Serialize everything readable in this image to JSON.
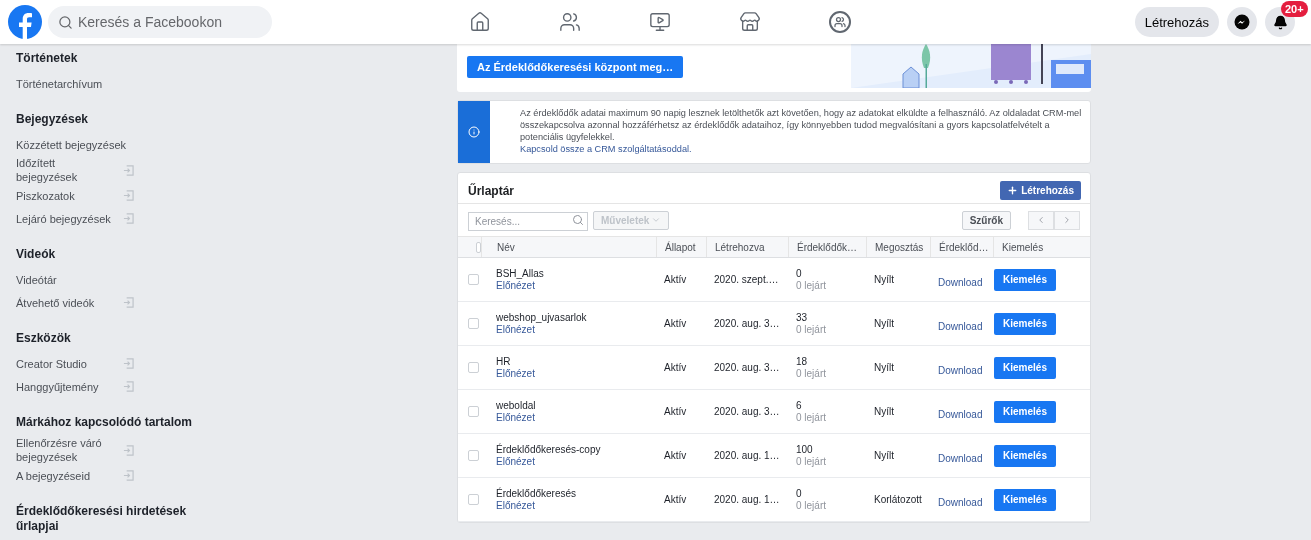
{
  "header": {
    "search": {
      "placeholder": "Keresés a Facebookon"
    },
    "create_button": "Létrehozás",
    "notification_badge": "20+"
  },
  "sidebar": {
    "sections": [
      {
        "title": "Történetek",
        "items": [
          {
            "label": "Történetarchívum",
            "external": false
          }
        ]
      },
      {
        "title": "Bejegyzések",
        "items": [
          {
            "label": "Közzétett bejegyzések",
            "external": false
          },
          {
            "label": "Időzített bejegyzések",
            "external": true
          },
          {
            "label": "Piszkozatok",
            "external": true
          },
          {
            "label": "Lejáró bejegyzések",
            "external": true
          }
        ]
      },
      {
        "title": "Videók",
        "items": [
          {
            "label": "Videótár",
            "external": false
          },
          {
            "label": "Átvehető videók",
            "external": true
          }
        ]
      },
      {
        "title": "Eszközök",
        "items": [
          {
            "label": "Creator Studio",
            "external": true
          },
          {
            "label": "Hanggyűjtemény",
            "external": true
          }
        ]
      },
      {
        "title": "Márkához kapcsolódó tartalom",
        "items": [
          {
            "label": "Ellenőrzésre váró bejegyzések",
            "external": true
          },
          {
            "label": "A bejegyzéseid",
            "external": true
          }
        ]
      },
      {
        "title": "Érdeklődőkeresési hirdetések űrlapjai"
      }
    ]
  },
  "banner": {
    "button": "Az Érdeklődőkeresési központ meg…"
  },
  "info": {
    "text": "Az érdeklődők adatai maximum 90 napig lesznek letölthetők azt követően, hogy az adatokat elküldte a felhasználó. Az oldaladat CRM-mel összekapcsolva azonnal hozzáférhetsz az érdeklődők adataihoz, így könnyebben tudod megvalósítani a gyors kapcsolatfelvételt a potenciális ügyfelekkel.",
    "link": "Kapcsold össze a CRM szolgáltatásoddal."
  },
  "library": {
    "title": "Űrlaptár",
    "create_button": "Létrehozás",
    "search": {
      "placeholder": "Keresés..."
    },
    "actions_button": "Műveletek",
    "select_all_checked": false,
    "filters_button": "Szűrők",
    "columns": [
      "Név",
      "Állapot",
      "Létrehozva",
      "Érdeklődők…",
      "Megosztás",
      "Érdeklőd…",
      "Kiemelés"
    ],
    "rows": [
      {
        "checked": false,
        "name": "BSH_Allas",
        "preview": "Előnézet",
        "status": "Aktív",
        "created": "2020. szept.…",
        "leads": "0",
        "expired": "0 lejárt",
        "sharing": "Nyílt",
        "download": "Download",
        "boost": "Kiemelés"
      },
      {
        "checked": false,
        "name": "webshop_ujvasarlok",
        "preview": "Előnézet",
        "status": "Aktív",
        "created": "2020. aug. 3…",
        "leads": "33",
        "expired": "0 lejárt",
        "sharing": "Nyílt",
        "download": "Download",
        "boost": "Kiemelés"
      },
      {
        "checked": false,
        "name": "HR",
        "preview": "Előnézet",
        "status": "Aktív",
        "created": "2020. aug. 3…",
        "leads": "18",
        "expired": "0 lejárt",
        "sharing": "Nyílt",
        "download": "Download",
        "boost": "Kiemelés"
      },
      {
        "checked": false,
        "name": "weboldal",
        "preview": "Előnézet",
        "status": "Aktív",
        "created": "2020. aug. 3…",
        "leads": "6",
        "expired": "0 lejárt",
        "sharing": "Nyílt",
        "download": "Download",
        "boost": "Kiemelés"
      },
      {
        "checked": false,
        "name": "Érdeklődőkeresés-copy",
        "preview": "Előnézet",
        "status": "Aktív",
        "created": "2020. aug. 1…",
        "leads": "100",
        "expired": "0 lejárt",
        "sharing": "Nyílt",
        "download": "Download",
        "boost": "Kiemelés"
      },
      {
        "checked": false,
        "name": "Érdeklődőkeresés",
        "preview": "Előnézet",
        "status": "Aktív",
        "created": "2020. aug. 1…",
        "leads": "0",
        "expired": "0 lejárt",
        "sharing": "Korlátozott",
        "download": "Download",
        "boost": "Kiemelés"
      }
    ]
  }
}
